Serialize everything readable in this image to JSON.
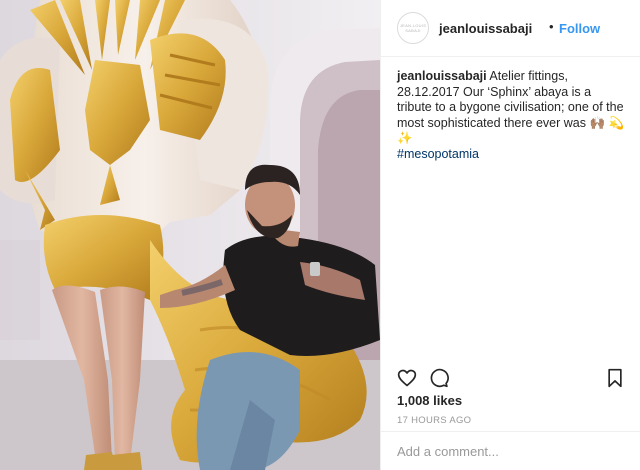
{
  "post": {
    "username": "jeanlouissabaji",
    "avatar_text": "JEAN LOUIS SABAJI",
    "dot": "•",
    "follow_label": "Follow",
    "caption": {
      "username": "jeanlouissabaji",
      "text": " Atelier fittings, 28.12.2017 Our ‘Sphinx’ abaya is a tribute to a bygone civilisation; one of the most sophisticated there ever was 🙌🏽 💫 ✨",
      "hashtag": "#mesopotamia"
    },
    "likes": "1,008 likes",
    "timestamp": "17 HOURS AGO",
    "comment_placeholder": "Add a comment...",
    "icons": {
      "like": "heart-icon",
      "comment": "comment-bubble-icon",
      "save": "bookmark-icon"
    },
    "colors": {
      "link": "#3897f0",
      "hashtag": "#003569",
      "muted": "#999999",
      "text": "#262626",
      "border": "#efefef",
      "gold": "#d9a83a"
    }
  }
}
